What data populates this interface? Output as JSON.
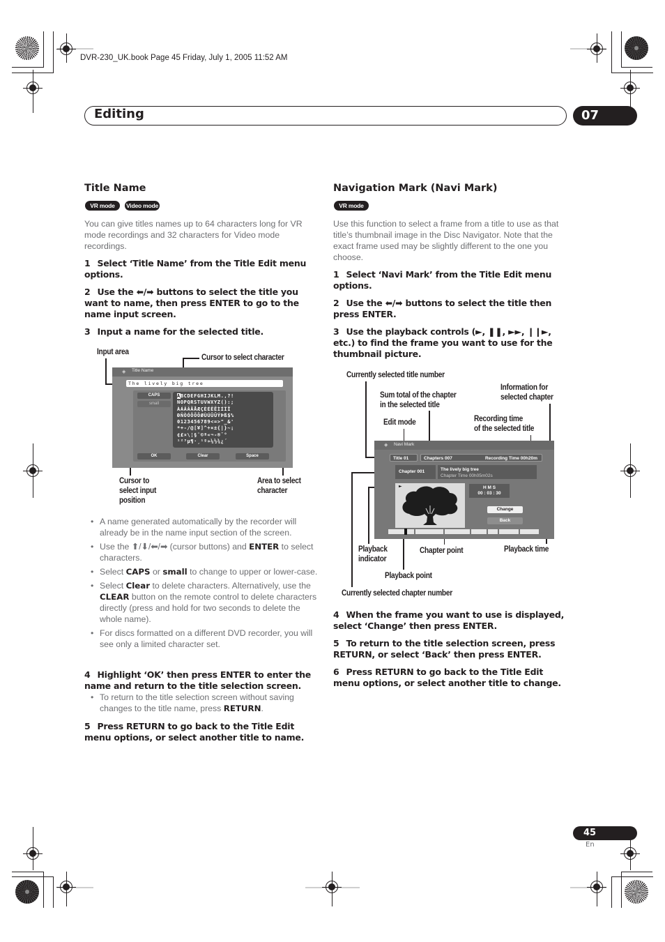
{
  "book_info": "DVR-230_UK.book  Page 45  Friday, July 1, 2005  11:52 AM",
  "header": {
    "section_title": "Editing",
    "chapter_number": "07"
  },
  "footer": {
    "page_number": "45",
    "language": "En"
  },
  "left": {
    "heading": "Title Name",
    "badges": [
      "VR mode",
      "Video mode"
    ],
    "intro": "You can give titles names up to 64 characters long for VR mode recordings and 32 characters for Video mode recordings.",
    "steps": [
      {
        "num": "1",
        "text": "Select ‘Title Name’ from the Title Edit menu options."
      },
      {
        "num": "2",
        "text": "Use the ⬅/➡ buttons to select the title you want to name, then press ENTER to go to the name input screen."
      },
      {
        "num": "3",
        "text": "Input a name for the selected title."
      },
      {
        "num": "4",
        "text": "Highlight ‘OK’ then press ENTER to enter the name and return to the title selection screen."
      },
      {
        "num": "5",
        "text": "Press RETURN to go back to the Title Edit menu options, or select another title to name."
      }
    ],
    "callouts": {
      "input_area": "Input area",
      "cursor_char": "Cursor to select character",
      "cursor_pos": [
        "Cursor to",
        "select input",
        "position"
      ],
      "area_char": [
        "Area to select",
        "character"
      ]
    },
    "screen": {
      "title": "Title Name",
      "input_value": "The lively big tree",
      "caps_label": "CAPS",
      "small_label": "small",
      "ok_label": "OK",
      "clear_label": "Clear",
      "space_label": "Space",
      "selected_char": "A",
      "char_rows": [
        "BCDEFGHIJKLM.,?!",
        "NOPQRSTUVWXYZ():;",
        "ÀÁÂÃÄÅÆÇÈÉÊËÌÍÎÏ",
        "ÐÑÒÓÔÕÖØÙÚÛÜÝÞß$%",
        "0123456789<=>\"_&'",
        "*+-/@[¥]^÷×±{|}~¡",
        "¢£¤\\¦§¨©ª«¬-®¯°",
        "¹²³µ¶·¸¹º»¼½¾¿´"
      ]
    },
    "bullets_a": [
      {
        "parts": [
          {
            "t": "A name generated automatically by the recorder will already be in the name input section of the screen."
          }
        ]
      },
      {
        "parts": [
          {
            "t": "Use the ⬆/⬇/⬅/➡ (cursor buttons) and "
          },
          {
            "b": "ENTER"
          },
          {
            "t": " to select characters."
          }
        ]
      },
      {
        "parts": [
          {
            "t": "Select "
          },
          {
            "b": "CAPS"
          },
          {
            "t": " or "
          },
          {
            "b": "small"
          },
          {
            "t": " to change to upper or lower-case."
          }
        ]
      },
      {
        "parts": [
          {
            "t": "Select "
          },
          {
            "b": "Clear"
          },
          {
            "t": " to delete characters. Alternatively, use the "
          },
          {
            "b": "CLEAR"
          },
          {
            "t": " button on the remote control to delete characters directly (press and hold for two seconds to delete the whole name)."
          }
        ]
      },
      {
        "parts": [
          {
            "t": "For discs formatted on a different DVD recorder, you will see only a limited character set."
          }
        ]
      }
    ],
    "bullets_b": [
      {
        "parts": [
          {
            "t": "To return to the title selection screen without saving changes to the title name, press "
          },
          {
            "b": "RETURN"
          },
          {
            "t": "."
          }
        ]
      }
    ]
  },
  "right": {
    "heading": "Navigation Mark (Navi Mark)",
    "badges": [
      "VR mode"
    ],
    "intro": "Use this function to select a frame from a title to use as that title’s thumbnail image in the Disc Navigator. Note that the exact frame used may be slightly different to the one you choose.",
    "steps": [
      {
        "num": "1",
        "text": "Select ‘Navi Mark’ from the Title Edit menu options."
      },
      {
        "num": "2",
        "text": "Use the ⬅/➡ buttons to select the title then press ENTER."
      },
      {
        "num": "3",
        "text": "Use the playback controls (►, ❚❚, ►►, ❙❙►, etc.) to find the frame you want to use for the thumbnail picture."
      },
      {
        "num": "4",
        "text": "When the frame you want to use is displayed, select ‘Change’ then press ENTER."
      },
      {
        "num": "5",
        "text": "To return to the title selection screen, press RETURN, or select ‘Back’ then press ENTER."
      },
      {
        "num": "6",
        "text": "Press RETURN to go back to the Title Edit menu options, or select another title to change."
      }
    ],
    "callouts": {
      "title_number": "Currently selected title number",
      "sum_chapters": [
        "Sum total of the chapter",
        "in the selected title"
      ],
      "info_chapter": [
        "Information for",
        "selected chapter"
      ],
      "edit_mode": "Edit mode",
      "recording_time": [
        "Recording time",
        "of the selected title"
      ],
      "playback_indicator": [
        "Playback",
        "indicator"
      ],
      "chapter_point": "Chapter point",
      "playback_time": "Playback time",
      "playback_point": "Playback point",
      "chapter_number": "Currently  selected chapter number"
    },
    "screen": {
      "title": "Navi Mark",
      "title_no": "Title 01",
      "chapters": "Chapters 007",
      "recording_time": "Recording Time  00h20m",
      "chapter_no": "Chapter 001",
      "chapter_name": "The lively big tree",
      "chapter_time": "Chapter Time  00h05m02s",
      "time_header": "H   M   S",
      "time_value": "00 : 03 : 30",
      "change_label": "Change",
      "back_label": "Back",
      "play_icon": "►",
      "playback_position": 0.04
    }
  }
}
